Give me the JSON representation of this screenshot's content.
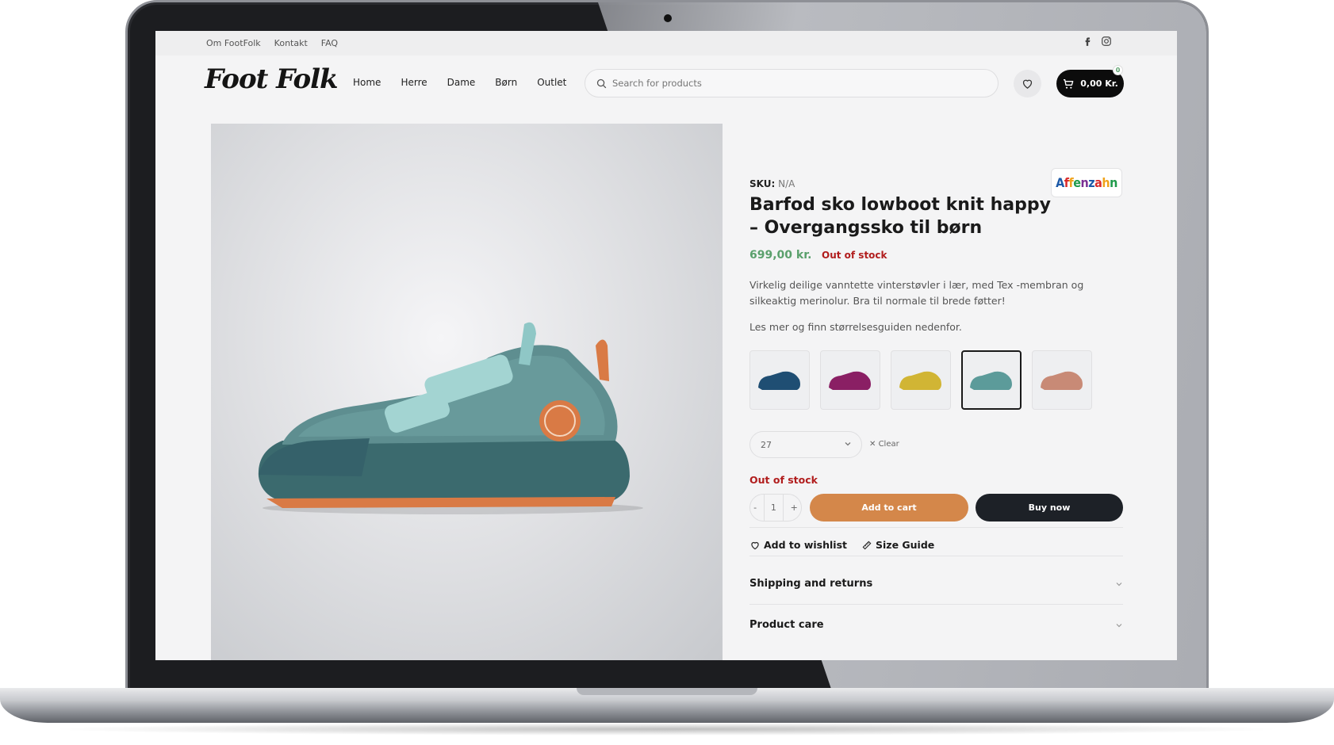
{
  "topbar": {
    "links": [
      "Om FootFolk",
      "Kontakt",
      "FAQ"
    ]
  },
  "header": {
    "logo": "Foot Folk",
    "nav": [
      "Home",
      "Herre",
      "Dame",
      "Børn",
      "Outlet"
    ],
    "search_placeholder": "Search for products",
    "cart_total": "0,00 Kr.",
    "cart_count": "0"
  },
  "product": {
    "sku_label": "SKU:",
    "sku_value": "N/A",
    "brand": "Affenzahn",
    "title": "Barfod sko lowboot knit happy – Overgangssko til børn",
    "price": "699,00 kr.",
    "stock_status": "Out of stock",
    "description": "Virkelig deilige vanntette vinterstøvler i lær, med Tex -membran og silkeaktig merinolur. Bra til normale til brede føtter!",
    "description_more": "Les mer og finn størrelsesguiden nedenfor.",
    "swatches": [
      {
        "color": "#1f4e73"
      },
      {
        "color": "#8a1f64"
      },
      {
        "color": "#d1b534"
      },
      {
        "color": "#5c9b9a"
      },
      {
        "color": "#c88a76"
      }
    ],
    "selected_size": "27",
    "clear_label": "Clear",
    "stock_message": "Out of stock",
    "quantity": "1",
    "qty_minus": "-",
    "qty_plus": "+",
    "add_to_cart": "Add to cart",
    "buy_now": "Buy now",
    "wishlist_label": "Add to wishlist",
    "size_guide_label": "Size Guide",
    "accordion": [
      "Shipping and returns",
      "Product care"
    ]
  },
  "colors": {
    "price_green": "#5aa06c",
    "out_of_stock_red": "#b11d1d",
    "add_cart_orange": "#d4874a",
    "buy_now_dark": "#1d2127"
  },
  "icons": {
    "social": [
      "facebook-icon",
      "instagram-icon"
    ],
    "header": [
      "search-icon",
      "heart-icon",
      "cart-icon"
    ]
  }
}
